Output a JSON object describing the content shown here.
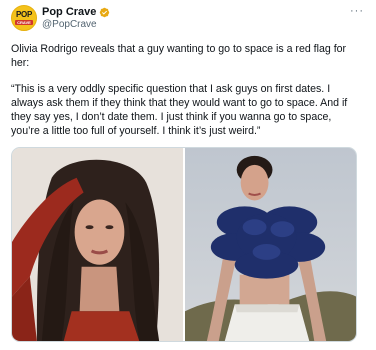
{
  "author": {
    "avatar_text_top": "POP",
    "avatar_text_bottom": "CRAVE",
    "display_name": "Pop Crave",
    "handle": "@PopCrave",
    "verified": true
  },
  "more_icon": "more-options-icon",
  "tweet": {
    "intro_lines": [
      "Olivia Rodrigo reveals that a guy wanting to go to space is a red flag for",
      "her:"
    ],
    "quote_lines": [
      "“This is a very oddly specific question that I ask guys on first dates. I",
      "always ask them if they think that they would want to go to space. And if",
      "they say yes, I don’t date them. I just think if you wanna go to space,",
      "you’re a little too full of yourself. I think it’s just weird.”"
    ]
  },
  "colors": {
    "accent": "#1d9bf0",
    "text": "#0f1419",
    "secondary_text": "#536471",
    "avatar_bg": "#f4c21b"
  }
}
